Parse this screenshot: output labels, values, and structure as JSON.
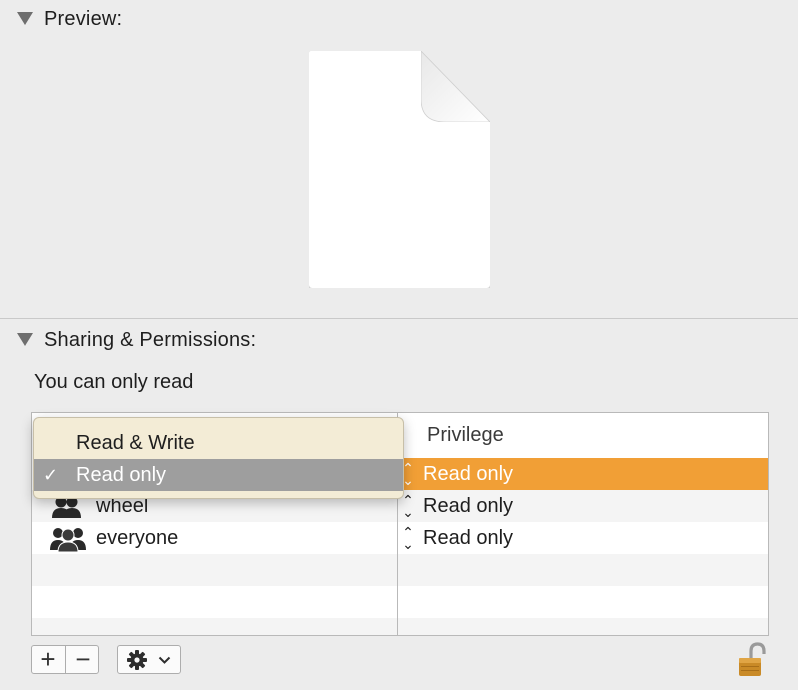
{
  "preview": {
    "title": "Preview:"
  },
  "sharing": {
    "title": "Sharing & Permissions:",
    "info": "You can only read",
    "table": {
      "column_privilege": "Privilege",
      "rows": [
        {
          "name": "",
          "privilege": "Read only",
          "selected": true
        },
        {
          "name": "wheel",
          "privilege": "Read only",
          "selected": false
        },
        {
          "name": "everyone",
          "privilege": "Read only",
          "selected": false
        }
      ]
    },
    "popup_menu": {
      "options": [
        "Read & Write",
        "Read only"
      ],
      "checked": "Read only"
    },
    "toolbar": {
      "add_label": "+",
      "remove_label": "−"
    }
  },
  "colors": {
    "selection": "#f19f36",
    "menu_background": "#f3ecd6",
    "menu_highlight": "#9e9e9e"
  }
}
